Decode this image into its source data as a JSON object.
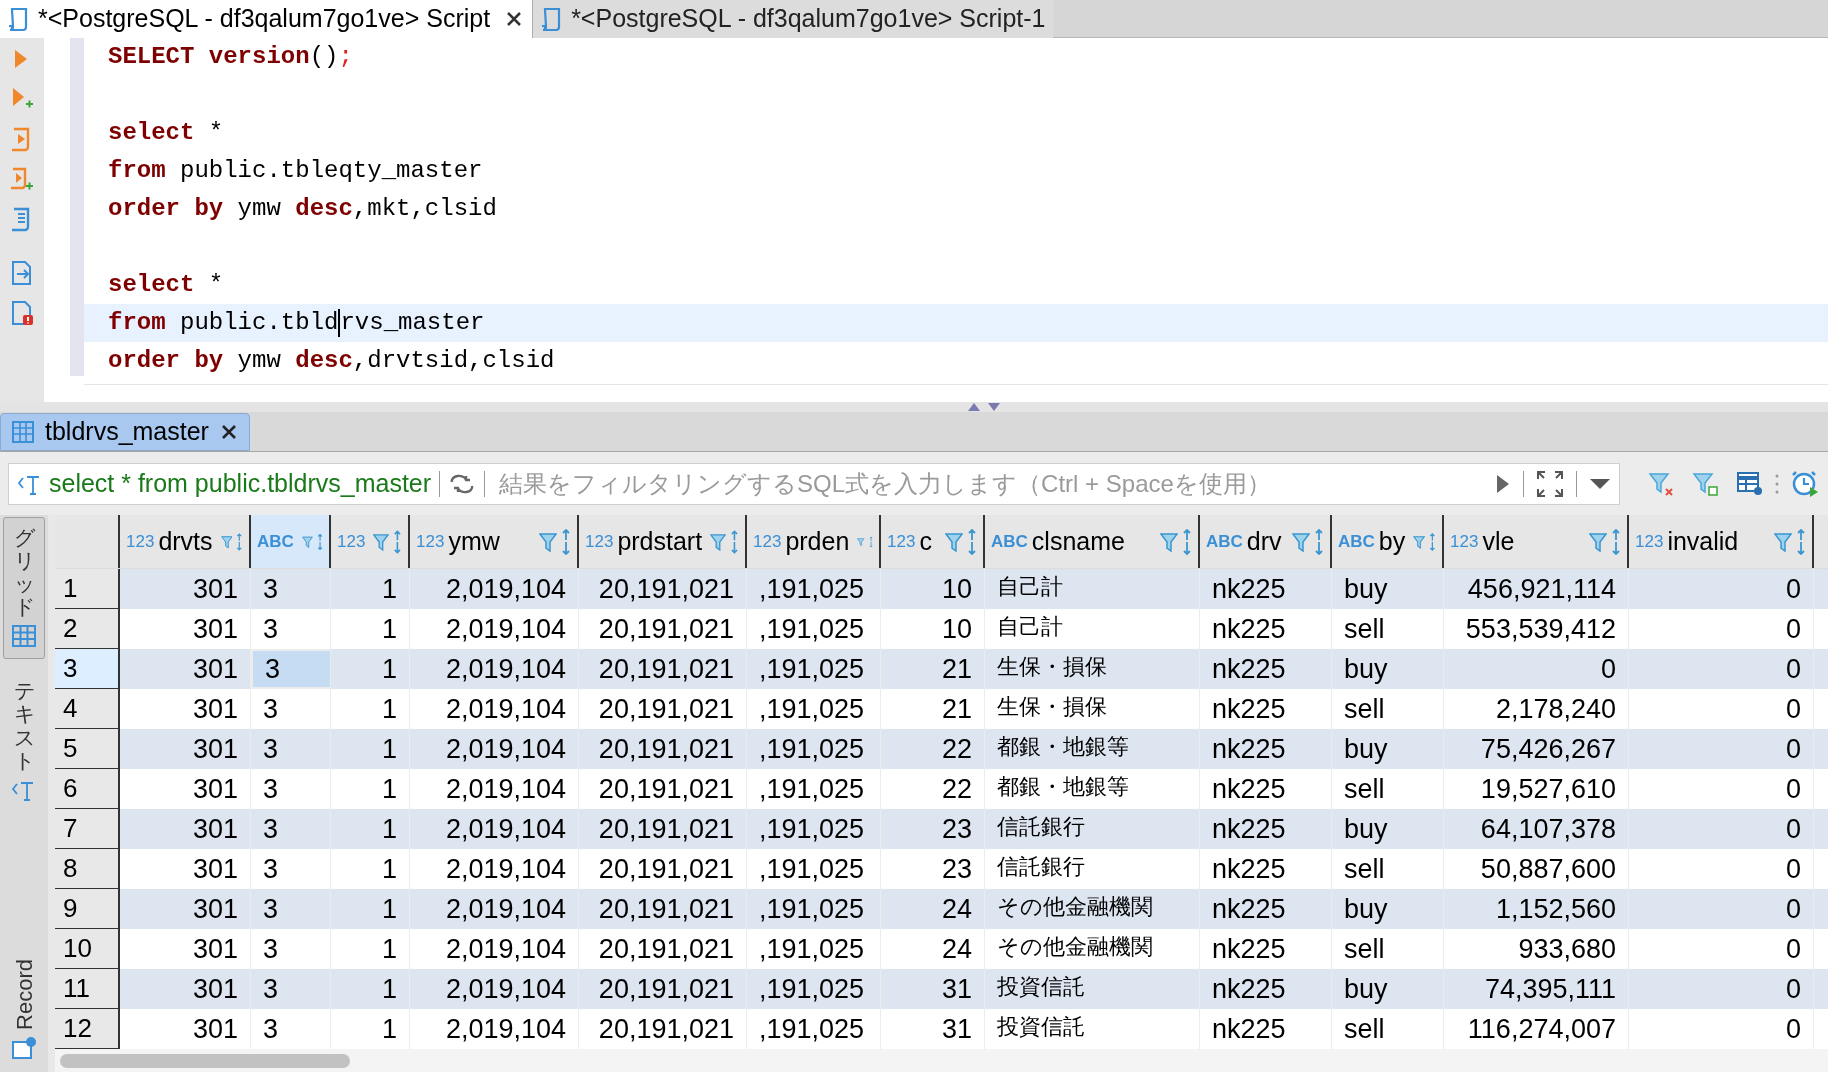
{
  "editor_tabs": [
    {
      "title": "*<PostgreSQL - df3qalum7go1ve> Script",
      "selected": true,
      "closable": true
    },
    {
      "title": "*<PostgreSQL - df3qalum7go1ve> Script-1",
      "selected": false,
      "closable": false
    }
  ],
  "editor": {
    "lines": [
      {
        "current": false,
        "tokens": [
          {
            "kind": "keyword",
            "text": "SELECT version"
          },
          {
            "kind": "plain",
            "text": "()"
          },
          {
            "kind": "punct",
            "text": ";"
          }
        ]
      },
      {
        "current": false
      },
      {
        "current": false,
        "tokens": [
          {
            "kind": "keyword",
            "text": "select"
          },
          {
            "kind": "plain",
            "text": " *"
          }
        ]
      },
      {
        "current": false,
        "tokens": [
          {
            "kind": "keyword",
            "text": "from"
          },
          {
            "kind": "plain",
            "text": " public.tbleqty_master"
          }
        ]
      },
      {
        "current": false,
        "tokens": [
          {
            "kind": "keyword",
            "text": "order by"
          },
          {
            "kind": "plain",
            "text": " ymw "
          },
          {
            "kind": "keyword",
            "text": "desc"
          },
          {
            "kind": "plain",
            "text": ",mkt,clsid"
          }
        ]
      },
      {
        "current": false
      },
      {
        "current": false,
        "tokens": [
          {
            "kind": "keyword",
            "text": "select"
          },
          {
            "kind": "plain",
            "text": " *"
          }
        ]
      },
      {
        "current": true,
        "tokens": [
          {
            "kind": "keyword",
            "text": "from"
          },
          {
            "kind": "plain",
            "text": " public.tbld"
          },
          {
            "kind": "cursor"
          },
          {
            "kind": "plain",
            "text": "rvs_master"
          }
        ]
      },
      {
        "current": false,
        "tokens": [
          {
            "kind": "keyword",
            "text": "order by"
          },
          {
            "kind": "plain",
            "text": " ymw "
          },
          {
            "kind": "keyword",
            "text": "desc"
          },
          {
            "kind": "plain",
            "text": ",drvtsid,clsid"
          }
        ]
      }
    ]
  },
  "results_tab": {
    "title": "tbldrvs_master",
    "selected": true
  },
  "filter_bar": {
    "query": "select * from public.tbldrvs_master",
    "placeholder": "結果をフィルタリングするSQL式を入力します（Ctrl + Spaceを使用）"
  },
  "side_tabs": [
    {
      "label": "グリッド",
      "selected": true,
      "kind": "cjk"
    },
    {
      "label": "テキスト",
      "selected": false,
      "kind": "cjk"
    },
    {
      "label": "Record",
      "selected": false,
      "kind": "latin"
    }
  ],
  "grid": {
    "columns": [
      {
        "type": "123",
        "label": "drvts",
        "kind": "number",
        "selected": false
      },
      {
        "type": "ABC",
        "kind": "text",
        "selected": true
      },
      {
        "type": "123",
        "kind": "number",
        "selected": false
      },
      {
        "type": "123",
        "label": "ymw",
        "kind": "number",
        "selected": false
      },
      {
        "type": "123",
        "label": "prdstart",
        "kind": "number",
        "selected": false
      },
      {
        "type": "123",
        "label": "prden",
        "kind": "text",
        "selected": false
      },
      {
        "type": "123",
        "label": "c",
        "kind": "number",
        "selected": false
      },
      {
        "type": "ABC",
        "label": "clsname",
        "kind": "japanese",
        "selected": false
      },
      {
        "type": "ABC",
        "label": "drv",
        "kind": "text",
        "selected": false
      },
      {
        "type": "ABC",
        "label": "by",
        "kind": "text",
        "selected": false
      },
      {
        "type": "123",
        "label": "vle",
        "kind": "number",
        "selected": false
      },
      {
        "type": "123",
        "label": "invalid",
        "kind": "number",
        "selected": false
      }
    ],
    "rows": [
      {
        "number": "1",
        "selected": false,
        "cells": [
          "301",
          "3",
          "1",
          "2,019,104",
          "20,191,021",
          ",191,025",
          "10",
          "自己計",
          "nk225",
          "buy",
          "456,921,114",
          "0"
        ]
      },
      {
        "number": "2",
        "selected": false,
        "cells": [
          "301",
          "3",
          "1",
          "2,019,104",
          "20,191,021",
          ",191,025",
          "10",
          "自己計",
          "nk225",
          "sell",
          "553,539,412",
          "0"
        ]
      },
      {
        "number": "3",
        "selected": true,
        "cells": [
          "301",
          "3",
          "1",
          "2,019,104",
          "20,191,021",
          ",191,025",
          "21",
          "生保・損保",
          "nk225",
          "buy",
          "0",
          "0"
        ]
      },
      {
        "number": "4",
        "selected": false,
        "cells": [
          "301",
          "3",
          "1",
          "2,019,104",
          "20,191,021",
          ",191,025",
          "21",
          "生保・損保",
          "nk225",
          "sell",
          "2,178,240",
          "0"
        ]
      },
      {
        "number": "5",
        "selected": false,
        "cells": [
          "301",
          "3",
          "1",
          "2,019,104",
          "20,191,021",
          ",191,025",
          "22",
          "都銀・地銀等",
          "nk225",
          "buy",
          "75,426,267",
          "0"
        ]
      },
      {
        "number": "6",
        "selected": false,
        "cells": [
          "301",
          "3",
          "1",
          "2,019,104",
          "20,191,021",
          ",191,025",
          "22",
          "都銀・地銀等",
          "nk225",
          "sell",
          "19,527,610",
          "0"
        ]
      },
      {
        "number": "7",
        "selected": false,
        "cells": [
          "301",
          "3",
          "1",
          "2,019,104",
          "20,191,021",
          ",191,025",
          "23",
          "信託銀行",
          "nk225",
          "buy",
          "64,107,378",
          "0"
        ]
      },
      {
        "number": "8",
        "selected": false,
        "cells": [
          "301",
          "3",
          "1",
          "2,019,104",
          "20,191,021",
          ",191,025",
          "23",
          "信託銀行",
          "nk225",
          "sell",
          "50,887,600",
          "0"
        ]
      },
      {
        "number": "9",
        "selected": false,
        "cells": [
          "301",
          "3",
          "1",
          "2,019,104",
          "20,191,021",
          ",191,025",
          "24",
          "その他金融機関",
          "nk225",
          "buy",
          "1,152,560",
          "0"
        ]
      },
      {
        "number": "10",
        "selected": false,
        "cells": [
          "301",
          "3",
          "1",
          "2,019,104",
          "20,191,021",
          ",191,025",
          "24",
          "その他金融機関",
          "nk225",
          "sell",
          "933,680",
          "0"
        ]
      },
      {
        "number": "11",
        "selected": false,
        "cells": [
          "301",
          "3",
          "1",
          "2,019,104",
          "20,191,021",
          ",191,025",
          "31",
          "投資信託",
          "nk225",
          "buy",
          "74,395,111",
          "0"
        ]
      },
      {
        "number": "12",
        "selected": false,
        "cells": [
          "301",
          "3",
          "1",
          "2,019,104",
          "20,191,021",
          ",191,025",
          "31",
          "投資信託",
          "nk225",
          "sell",
          "116,274,007",
          "0"
        ]
      }
    ]
  }
}
